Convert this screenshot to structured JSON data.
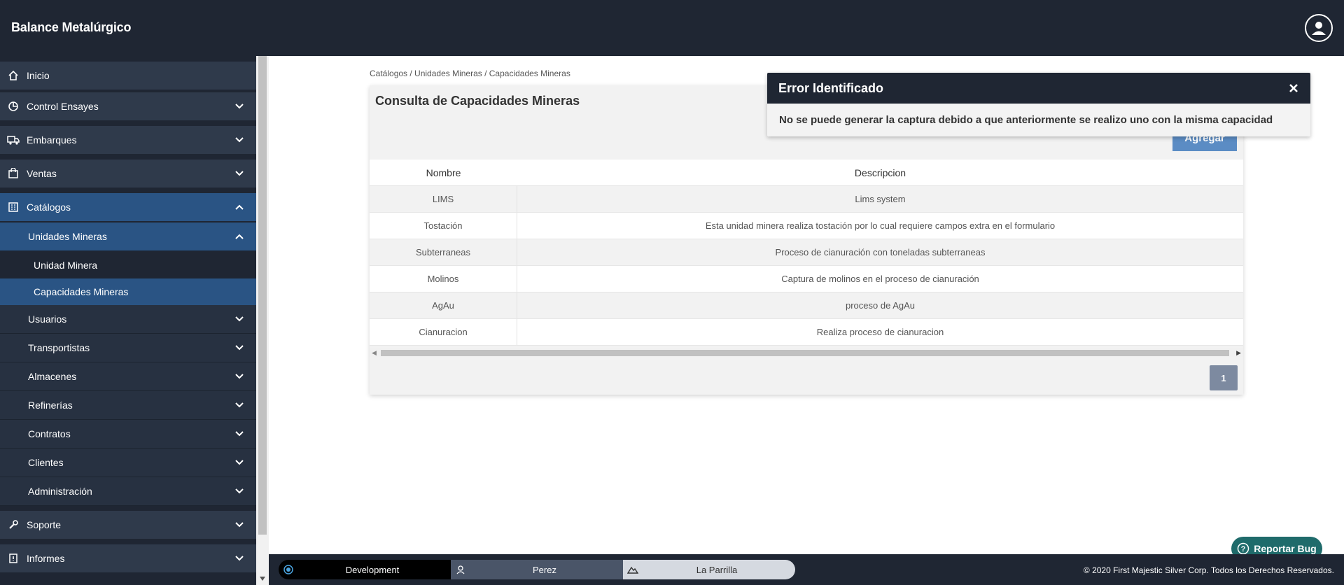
{
  "app": {
    "title": "Balance Metalúrgico"
  },
  "sidebar": {
    "inicio": "Inicio",
    "control_ensayes": "Control Ensayes",
    "embarques": "Embarques",
    "ventas": "Ventas",
    "catalogos": "Catálogos",
    "unidades_mineras": "Unidades Mineras",
    "unidad_minera": "Unidad Minera",
    "capacidades_mineras": "Capacidades Mineras",
    "usuarios": "Usuarios",
    "transportistas": "Transportistas",
    "almacenes": "Almacenes",
    "refinerias": "Refinerías",
    "contratos": "Contratos",
    "clientes": "Clientes",
    "administracion": "Administración",
    "soporte": "Soporte",
    "informes": "Informes"
  },
  "breadcrumb": "Catálogos / Unidades Mineras / Capacidades Mineras",
  "card": {
    "title": "Consulta de Capacidades Mineras",
    "add_label": "Agregar"
  },
  "table": {
    "headers": [
      "Nombre",
      "Descripcion"
    ],
    "rows": [
      [
        "LIMS",
        "Lims system"
      ],
      [
        "Tostación",
        "Esta unidad minera realiza tostación por lo cual requiere campos extra en el formulario"
      ],
      [
        "Subterraneas",
        "Proceso de cianuración con toneladas subterraneas"
      ],
      [
        "Molinos",
        "Captura de molinos en el proceso de cianuración"
      ],
      [
        "AgAu",
        "proceso de AgAu"
      ],
      [
        "Cianuracion",
        "Realiza proceso de cianuracion"
      ]
    ]
  },
  "pagination": {
    "current": "1"
  },
  "toast": {
    "title": "Error Identificado",
    "message": "No se puede generar la captura debido a que anteriormente se realizo uno con la misma capacidad"
  },
  "footer": {
    "environment": "Development",
    "user": "Perez",
    "site": "La Parrilla",
    "copyright": "© 2020 First Majestic Silver Corp. Todos los Derechos Reservados."
  },
  "bug_button": {
    "label": "Reportar Bug"
  },
  "colors": {
    "nav_bg": "#1f2633",
    "nav_item": "#2f3a4b",
    "active": "#2a5484",
    "accent_button": "#5b8cc4",
    "bug_button": "#1f6b6b"
  }
}
